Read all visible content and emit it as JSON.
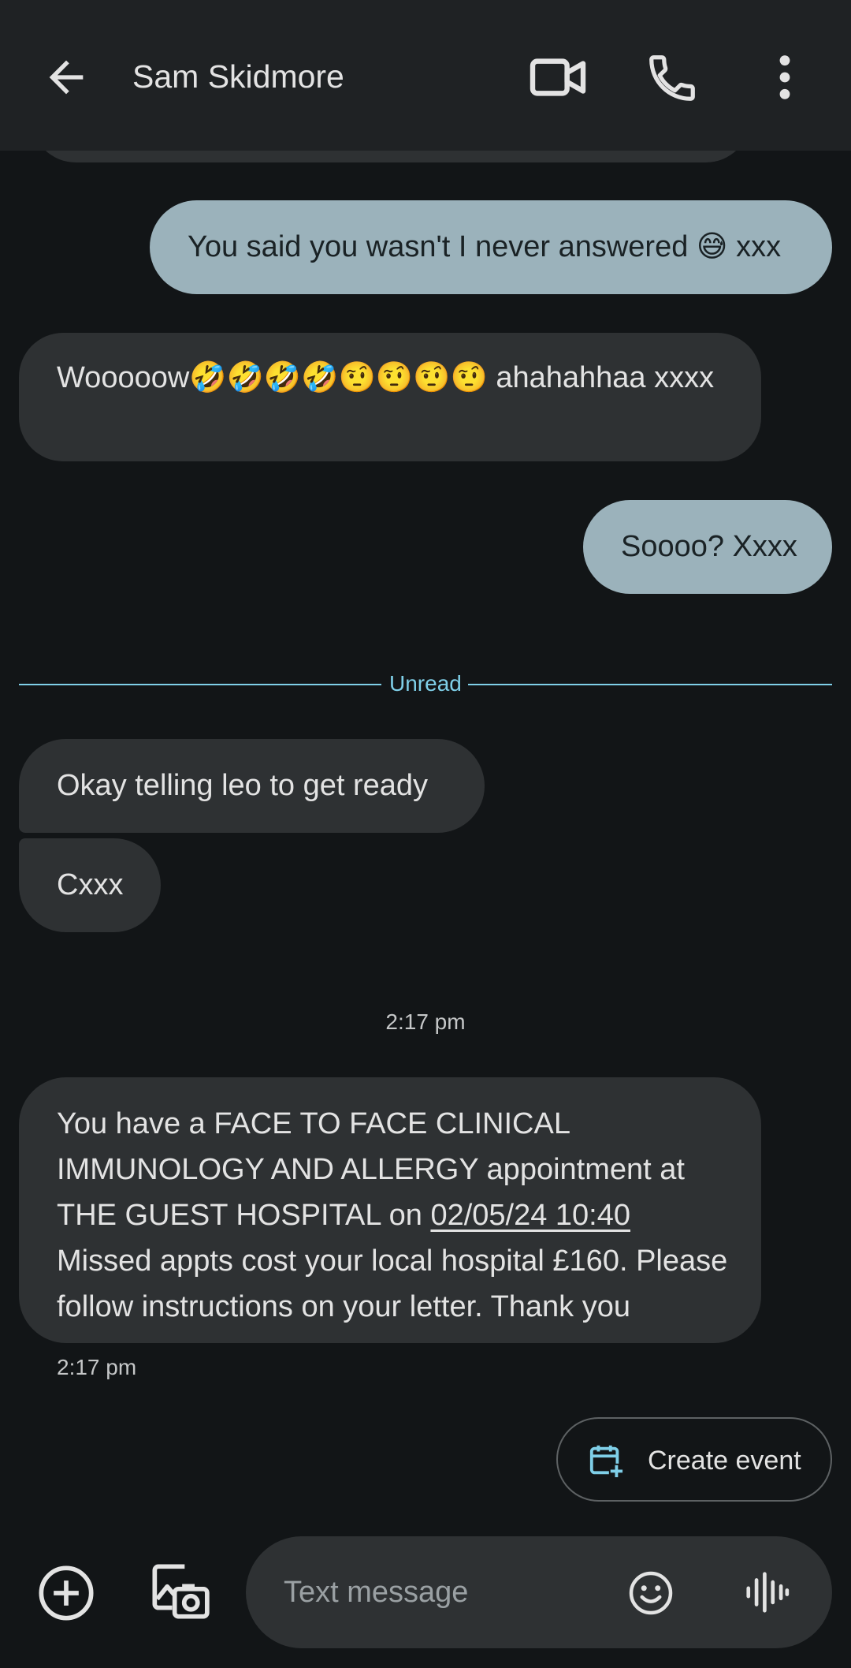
{
  "header": {
    "contact_name": "Sam Skidmore",
    "icons": [
      "back-arrow-icon",
      "video-call-icon",
      "phone-icon",
      "more-vert-icon"
    ]
  },
  "messages": [
    {
      "direction": "outgoing",
      "text": "You said you wasn't I never answered 😅 xxx"
    },
    {
      "direction": "incoming",
      "text": "Wooooow🤣🤣🤣🤣🤨🤨🤨🤨 ahahahhaa xxxx"
    },
    {
      "direction": "outgoing",
      "text": "Soooo? Xxxx"
    },
    {
      "direction": "incoming",
      "text": "Okay telling leo to get ready"
    },
    {
      "direction": "incoming",
      "text": "Cxxx"
    },
    {
      "direction": "incoming",
      "text_before": "You have a FACE TO FACE CLINICAL IMMUNOLOGY AND ALLERGY appointment at THE GUEST HOSPITAL on ",
      "link": "02/05/24 10:40",
      "text_after": " Missed appts cost your local hospital £160. Please follow instructions on your letter. Thank you"
    }
  ],
  "unread_label": "Unread",
  "timestamp_center": "2:17 pm",
  "timestamp_message": "2:17 pm",
  "suggestion": {
    "label": "Create event",
    "icon": "calendar-add-icon"
  },
  "composer": {
    "placeholder": "Text message",
    "icons": [
      "add-circle-icon",
      "gallery-camera-icon",
      "emoji-icon",
      "voice-icon"
    ]
  },
  "colors": {
    "background": "#121517",
    "appbar": "#1f2224",
    "incoming_bubble": "#2e3133",
    "outgoing_bubble": "#9bb2bb",
    "accent": "#7fcfe8"
  }
}
